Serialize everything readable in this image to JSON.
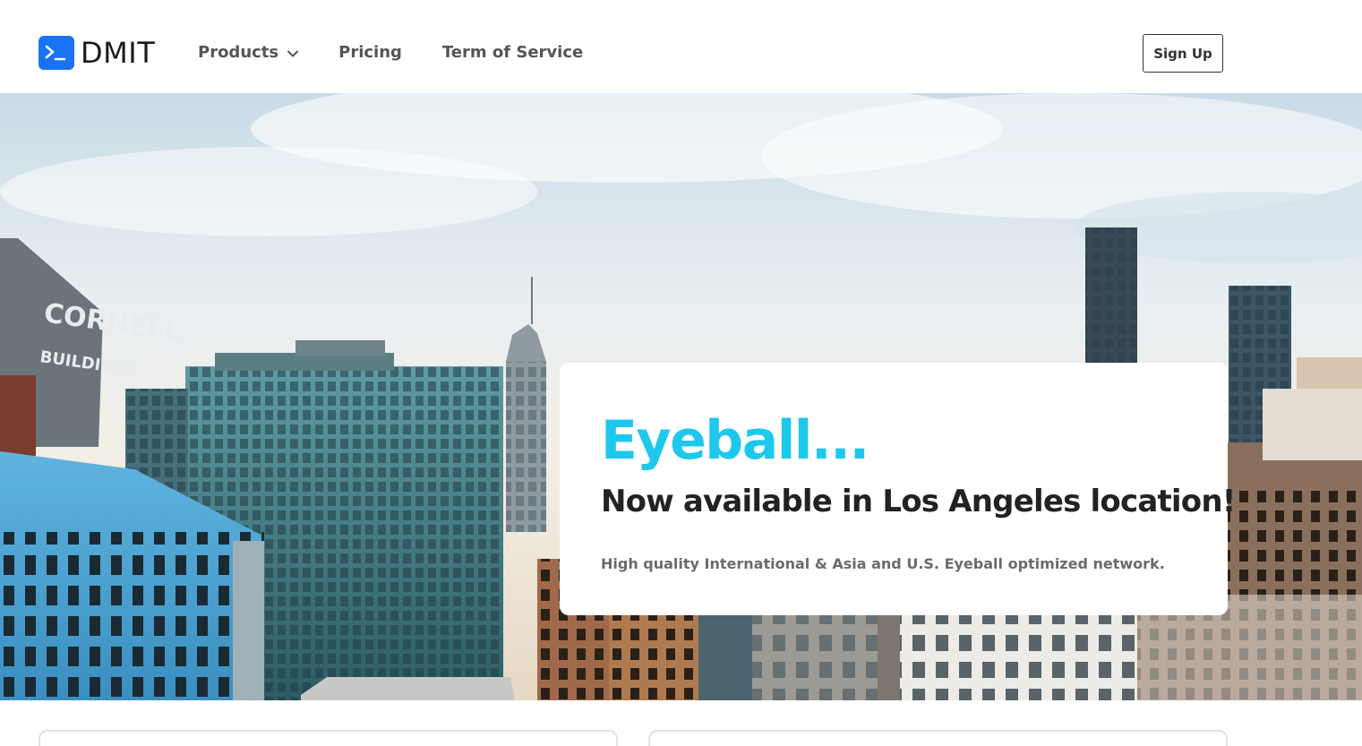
{
  "brand": {
    "name": "DMIT",
    "logo_color": "#1a73f5"
  },
  "nav": {
    "items": [
      {
        "label": "Products",
        "has_dropdown": true,
        "icon": "chevron-down-icon"
      },
      {
        "label": "Pricing"
      },
      {
        "label": "Term of Service"
      }
    ],
    "signup_label": "Sign Up"
  },
  "hero": {
    "title": "Eyeball...",
    "subtitle": "Now available in Los Angeles location!",
    "description": "High quality International & Asia and U.S. Eyeball optimized network.",
    "title_color": "#1ec8ec",
    "building_sign_line1": "CORNELL",
    "building_sign_line2": "BUILDINGS"
  },
  "colors": {
    "accent": "#1a73f5",
    "title": "#1ec8ec",
    "text": "#222222",
    "muted": "#6b6b6b"
  }
}
